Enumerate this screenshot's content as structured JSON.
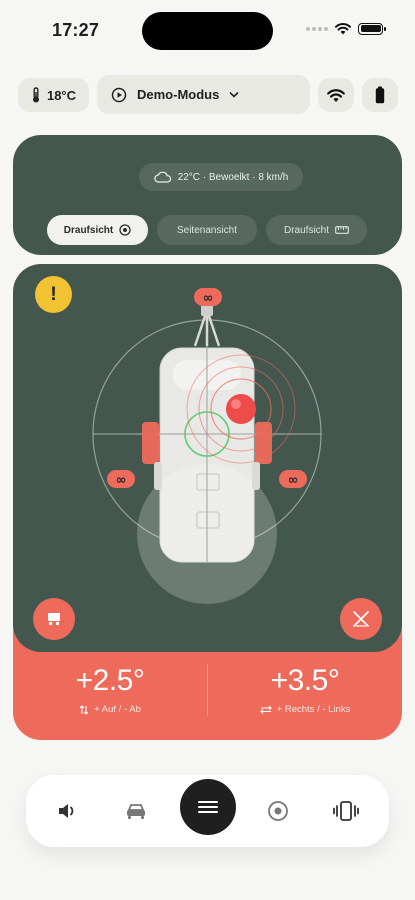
{
  "status_bar": {
    "time": "17:27"
  },
  "header": {
    "temperature": "18°C",
    "mode": "Demo-Modus"
  },
  "weather": {
    "text": "22°C · Bewoelkt · 8 km/h"
  },
  "view_tabs": [
    {
      "label": "Draufsicht",
      "active": true,
      "icon": "target-icon"
    },
    {
      "label": "Seitenansicht",
      "active": false
    },
    {
      "label": "Draufsicht",
      "active": false,
      "icon": "ruler-icon"
    }
  ],
  "readouts": {
    "pitch": {
      "value": "+2.5°",
      "label": "+ Auf / - Ab"
    },
    "roll": {
      "value": "+3.5°",
      "label": "+ Rechts / - Links"
    }
  },
  "colors": {
    "panel": "#44574f",
    "accent": "#ee6b5b",
    "warning": "#f1c232",
    "background": "#f6f6f4"
  },
  "bottom_nav": [
    "speaker-icon",
    "car-icon",
    "menu-icon",
    "target-icon",
    "vibrate-icon"
  ]
}
